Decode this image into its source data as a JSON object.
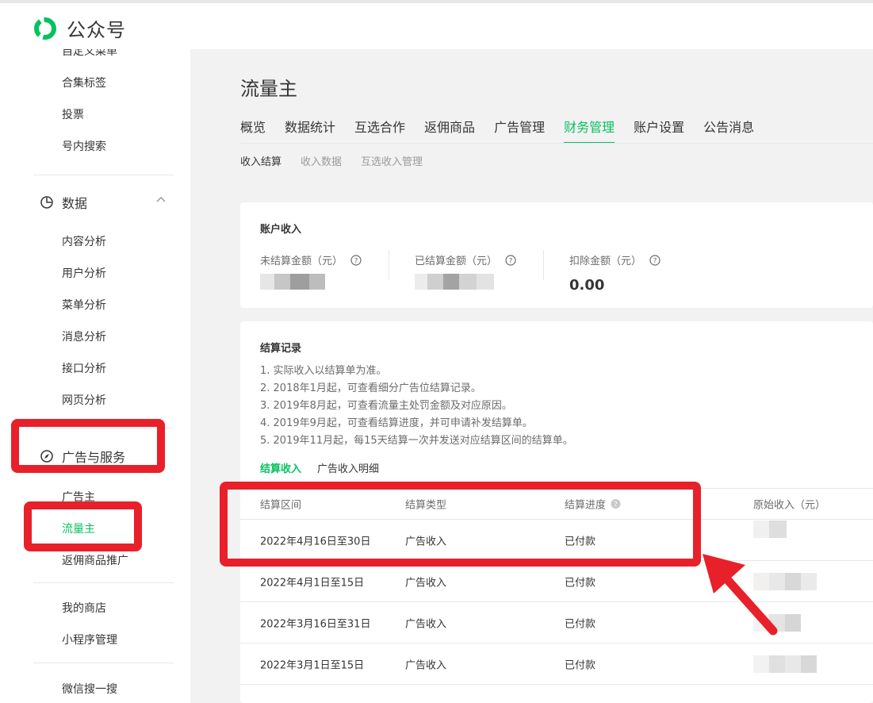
{
  "app": {
    "name": "公众号",
    "logo_icon": "wechat-official-account-logo-icon"
  },
  "sidebar": {
    "items_top": [
      "自定义菜单",
      "合集标签",
      "投票",
      "号内搜索"
    ],
    "data_group": {
      "label": "数据",
      "icon": "pie-chart-icon",
      "toggle_icon": "chevron-up-icon"
    },
    "data_items": [
      "内容分析",
      "用户分析",
      "菜单分析",
      "消息分析",
      "接口分析",
      "网页分析"
    ],
    "ads_group": {
      "label": "广告与服务",
      "icon": "compass-icon"
    },
    "ads_items": [
      "广告主",
      "流量主",
      "返佣商品推广"
    ],
    "active_item": "流量主",
    "bottom_items": [
      "我的商店",
      "小程序管理",
      "微信搜一搜"
    ]
  },
  "page": {
    "title": "流量主",
    "tabs": [
      "概览",
      "数据统计",
      "互选合作",
      "返佣商品",
      "广告管理",
      "财务管理",
      "账户设置",
      "公告消息"
    ],
    "active_tab": "财务管理",
    "subtabs": [
      "收入结算",
      "收入数据",
      "互选收入管理"
    ],
    "active_subtab": "收入结算"
  },
  "income": {
    "title": "账户收入",
    "unsettled_label": "未结算金额（元）",
    "settled_label": "已结算金额（元）",
    "deducted_label": "扣除金额（元）",
    "deducted_value": "0.00",
    "help_icon": "question-circle-icon"
  },
  "records": {
    "title": "结算记录",
    "notes": [
      "1. 实际收入以结算单为准。",
      "2. 2018年1月起，可查看细分广告位结算记录。",
      "3. 2019年8月起，可查看流量主处罚金额及对应原因。",
      "4. 2019年9月起，可查看结算进度，并可申请补发结算单。",
      "5. 2019年11月起，每15天结算一次并发送对应结算区间的结算单。"
    ],
    "tabs": [
      "结算收入",
      "广告收入明细"
    ],
    "active_tab": "结算收入",
    "columns": [
      "结算区间",
      "结算类型",
      "结算进度",
      "原始收入（元）"
    ],
    "rows": [
      {
        "period": "2022年4月16日至30日",
        "type": "广告收入",
        "status": "已付款"
      },
      {
        "period": "2022年4月1日至15日",
        "type": "广告收入",
        "status": "已付款"
      },
      {
        "period": "2022年3月16日至31日",
        "type": "广告收入",
        "status": "已付款"
      },
      {
        "period": "2022年3月1日至15日",
        "type": "广告收入",
        "status": "已付款"
      }
    ]
  },
  "colors": {
    "accent": "#07c160",
    "highlight": "#e8202a",
    "text": "#353535",
    "muted": "#9a9a9a"
  }
}
